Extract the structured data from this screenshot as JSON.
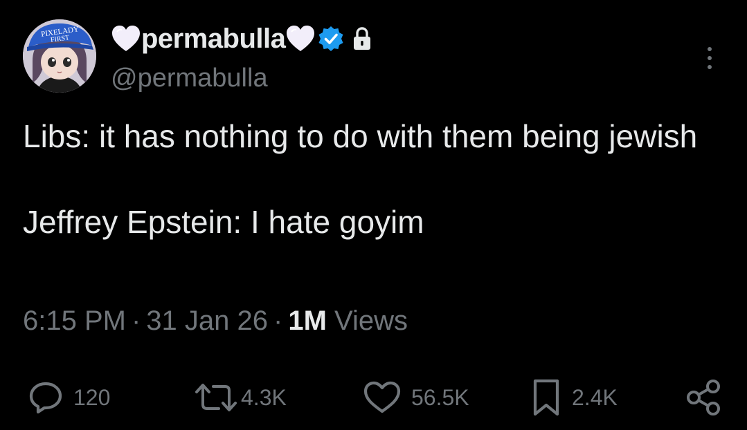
{
  "user": {
    "display_name": "permabulla",
    "handle": "@permabulla",
    "avatar_hat_text": "PIXELADY FIRST",
    "verified": true,
    "protected": true
  },
  "tweet": {
    "line1": "Libs: it has nothing to do with them being jewish",
    "line2": "Jeffrey Epstein: I hate goyim",
    "time": "6:15 PM",
    "date": "31 Jan 26",
    "views_count": "1M",
    "views_label": "Views"
  },
  "actions": {
    "replies": "120",
    "reposts": "4.3K",
    "likes": "56.5K",
    "bookmarks": "2.4K"
  },
  "colors": {
    "background": "#000000",
    "text": "#e7e9ea",
    "muted": "#71767b",
    "verified_blue": "#1d9bf0"
  },
  "icons": [
    "heart-emoji-icon",
    "verified-badge-icon",
    "lock-icon",
    "more-options-icon",
    "reply-icon",
    "repost-icon",
    "like-icon",
    "bookmark-icon",
    "share-icon"
  ]
}
